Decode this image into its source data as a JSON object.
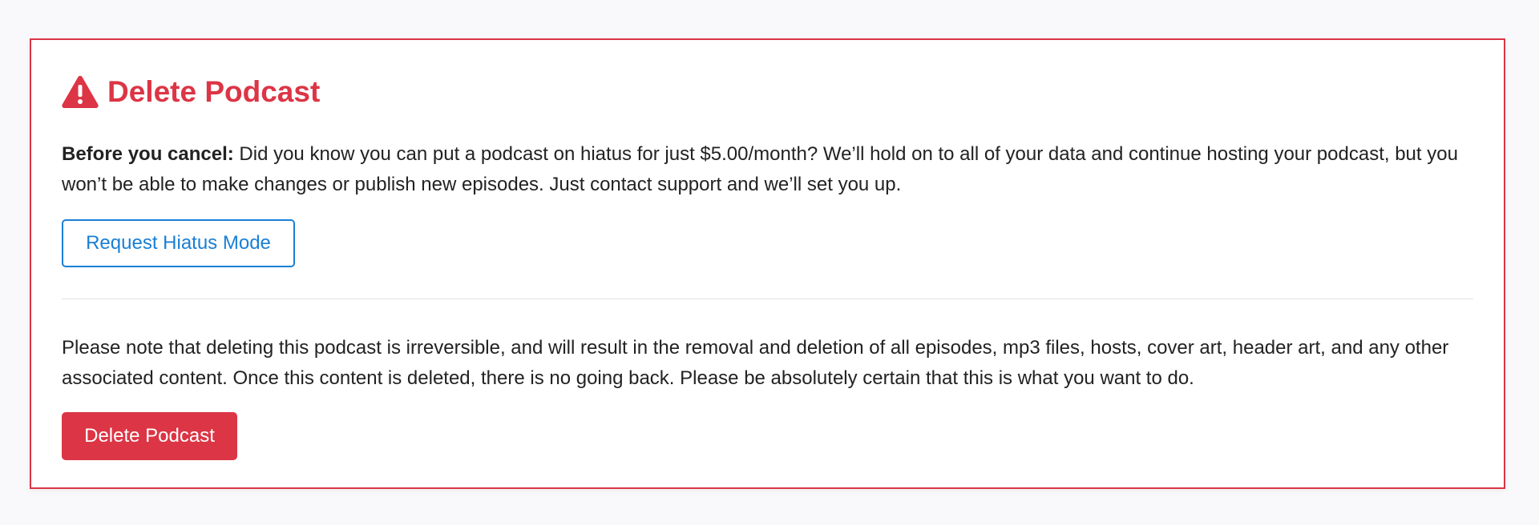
{
  "panel": {
    "title": "Delete Podcast",
    "icon": "warning-icon",
    "accent_color": "#dc3545"
  },
  "hiatus": {
    "lead": "Before you cancel:",
    "body": " Did you know you can put a podcast on hiatus for just $5.00/month? We’ll hold on to all of your data and continue hosting your podcast, but you won’t be able to make changes or publish new episodes. Just contact support and we’ll set you up.",
    "button_label": "Request Hiatus Mode",
    "button_color": "#1a7fd4"
  },
  "deletion": {
    "warning_text": "Please note that deleting this podcast is irreversible, and will result in the removal and deletion of all episodes, mp3 files, hosts, cover art, header art, and any other associated content. Once this content is deleted, there is no going back. Please be absolutely certain that this is what you want to do.",
    "button_label": "Delete Podcast"
  }
}
